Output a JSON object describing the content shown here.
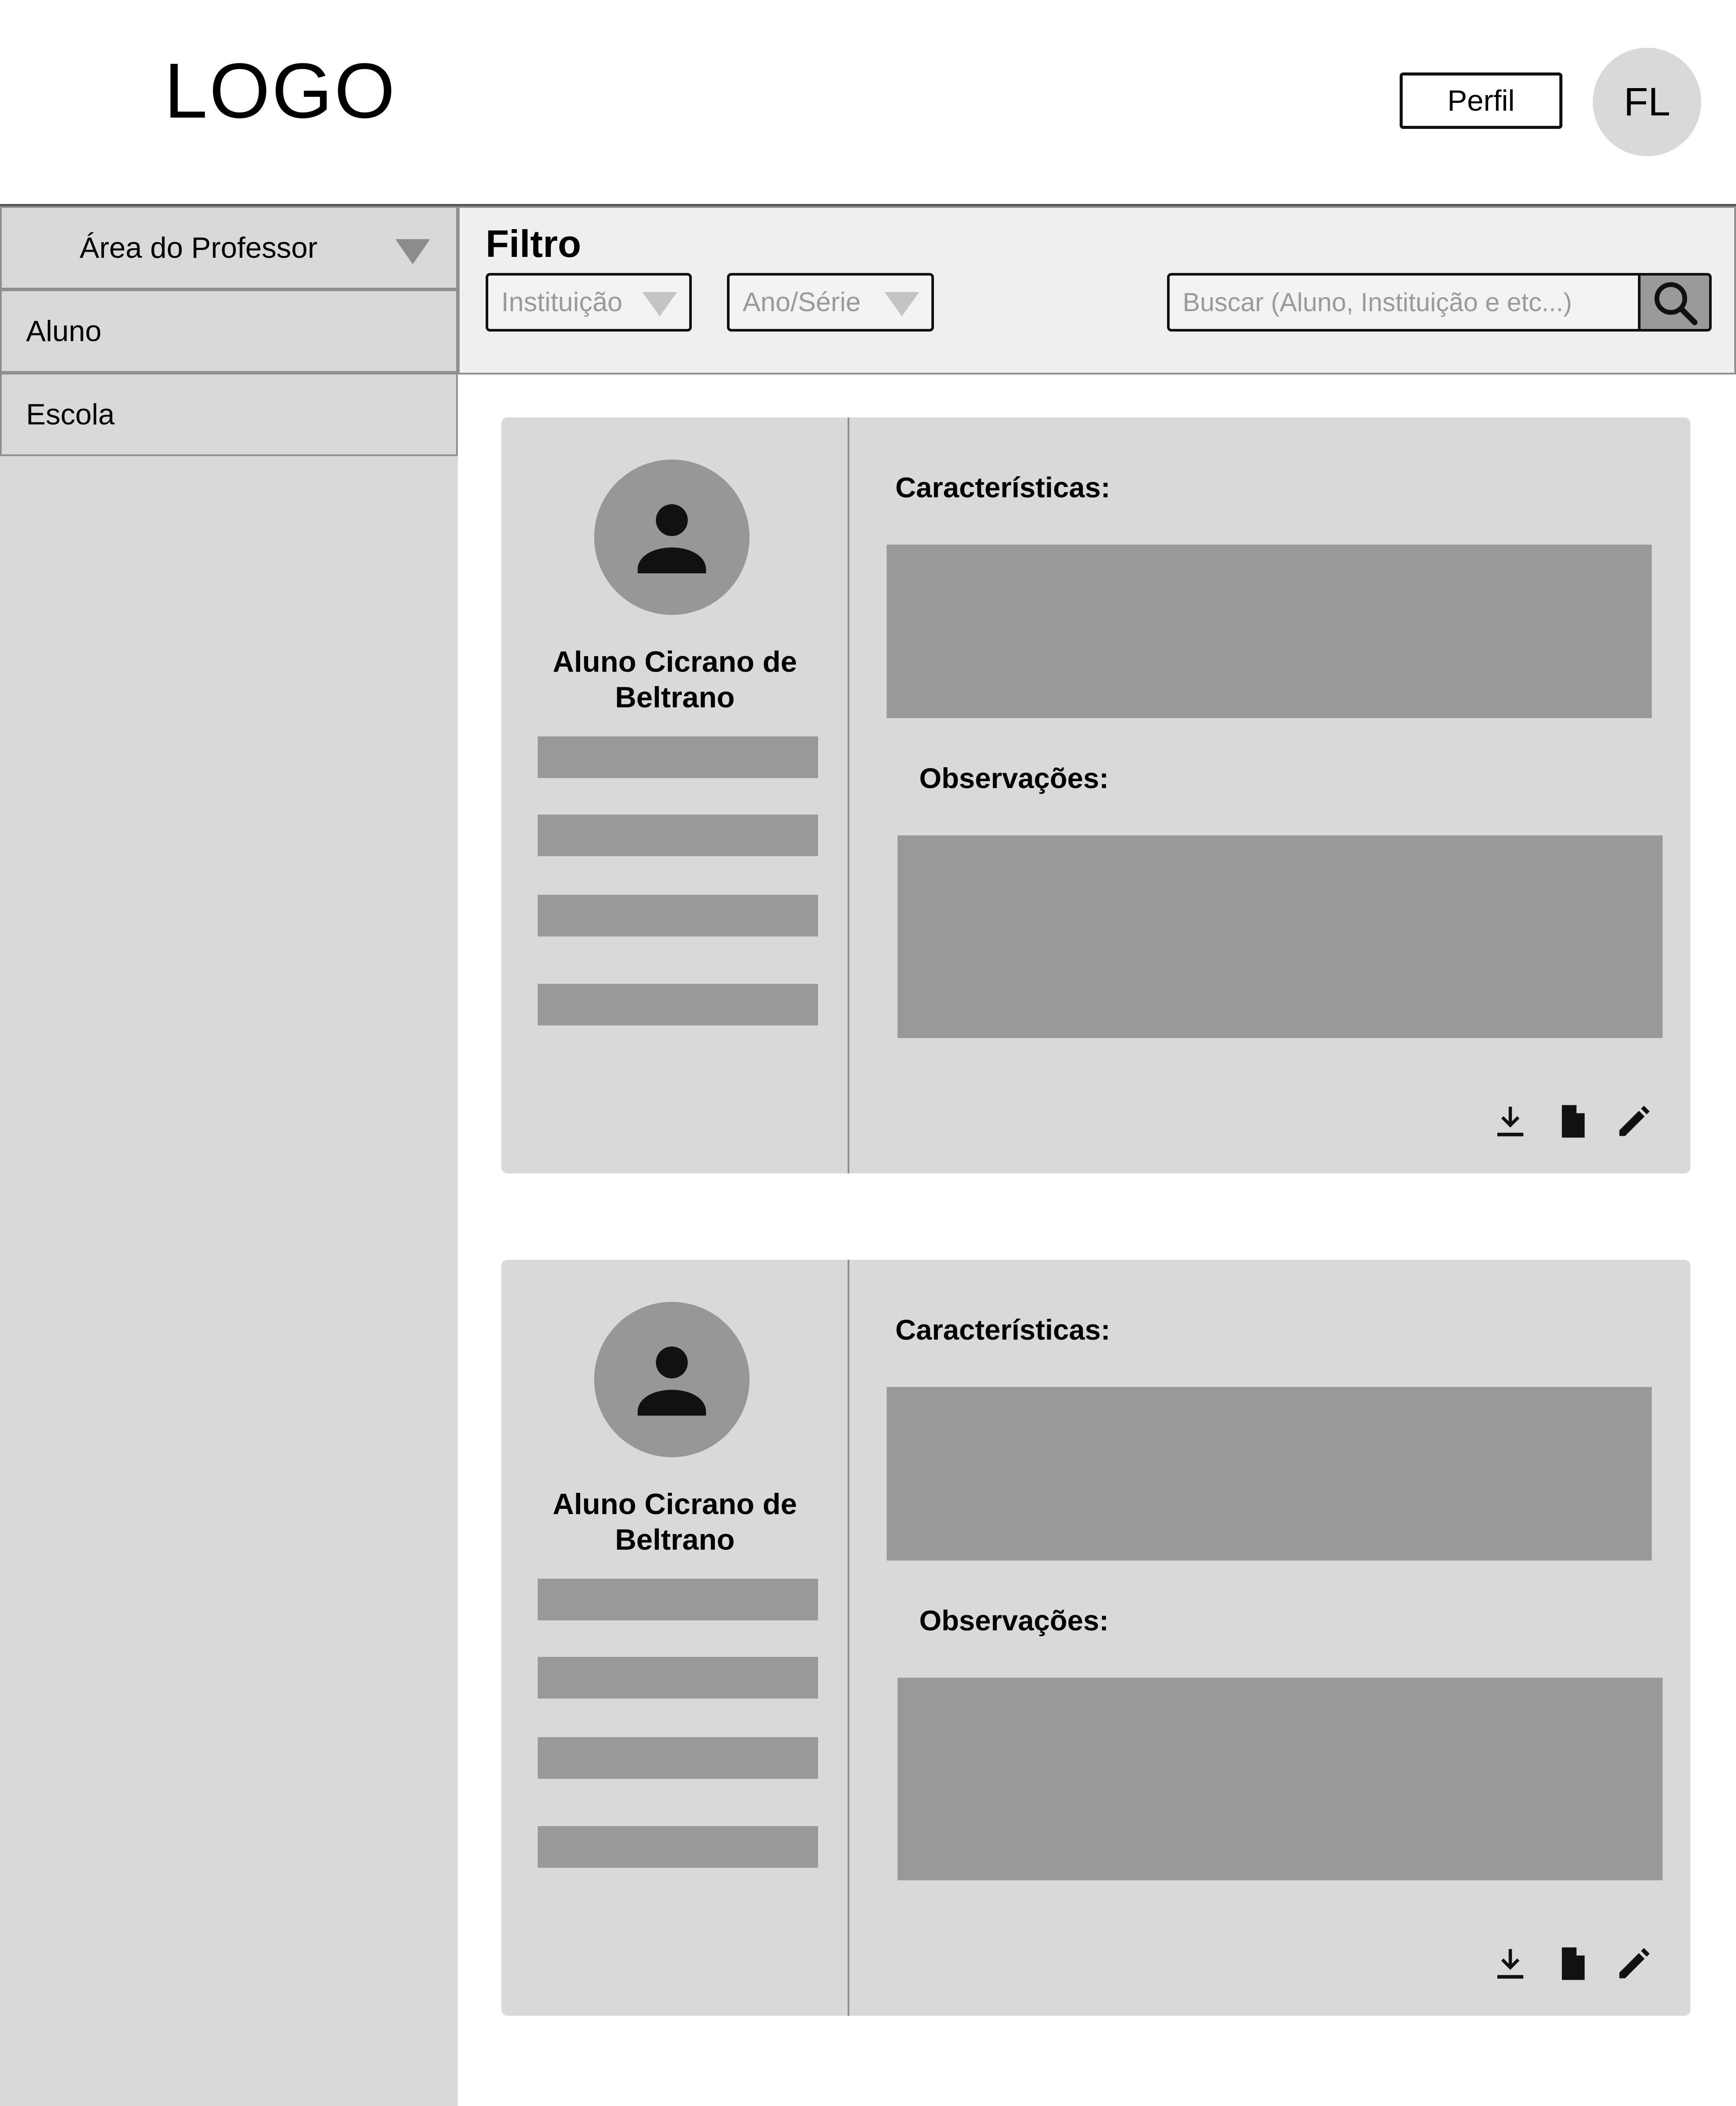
{
  "header": {
    "logo": "LOGO",
    "profile_button": "Perfil",
    "user_initials": "FL"
  },
  "sidebar": {
    "section_title": "Área do Professor",
    "items": [
      {
        "label": "Aluno"
      },
      {
        "label": "Escola"
      }
    ]
  },
  "filter": {
    "title": "Filtro",
    "institution_select": "Instituição",
    "grade_select": "Ano/Série",
    "search_placeholder": "Buscar (Aluno, Instituição e etc...)"
  },
  "cards": [
    {
      "student_name": "Aluno Cicrano de Beltrano",
      "characteristics_label": "Características:",
      "observations_label": "Observações:"
    },
    {
      "student_name": "Aluno Cicrano de Beltrano",
      "characteristics_label": "Características:",
      "observations_label": "Observações:"
    }
  ],
  "icons": {
    "download": "download-icon",
    "document": "document-icon",
    "edit": "edit-icon",
    "search": "search-icon",
    "dropdown": "triangle-down-icon",
    "user": "user-icon"
  }
}
